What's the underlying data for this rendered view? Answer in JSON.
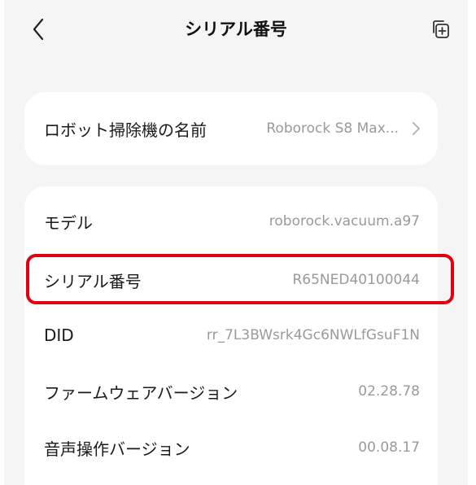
{
  "header": {
    "title": "シリアル番号",
    "back_icon": "chevron-left-icon",
    "copy_icon": "copy-add-icon"
  },
  "robot_name": {
    "label": "ロボット掃除機の名前",
    "value": "Roborock S8 Max...",
    "chevron_icon": "chevron-right-icon"
  },
  "info": {
    "rows": [
      {
        "label": "モデル",
        "value": "roborock.vacuum.a97"
      },
      {
        "label": "シリアル番号",
        "value": "R65NED40100044"
      },
      {
        "label": "DID",
        "value": "rr_7L3BWsrk4Gc6NWLfGsuF1N"
      },
      {
        "label": "ファームウェアバージョン",
        "value": "02.28.78"
      },
      {
        "label": "音声操作バージョン",
        "value": "00.08.17"
      }
    ]
  },
  "colors": {
    "background": "#f5f5f6",
    "card": "#ffffff",
    "highlight": "#e0000f",
    "value_text": "#9a9a9a"
  }
}
